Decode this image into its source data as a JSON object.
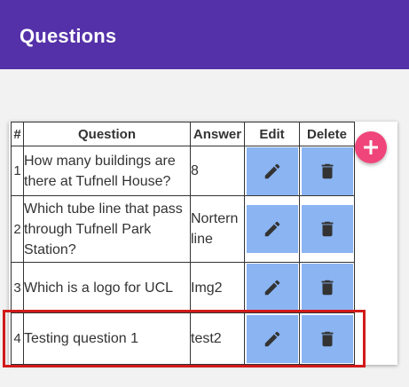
{
  "app_bar": {
    "title": "Questions",
    "color": "#5431a9"
  },
  "table": {
    "headers": {
      "num": "#",
      "question": "Question",
      "answer": "Answer",
      "edit": "Edit",
      "delete": "Delete"
    },
    "rows": [
      {
        "num": "1",
        "question": "How many buildings are there at Tufnell House?",
        "answer": "8"
      },
      {
        "num": "2",
        "question": "Which tube line that pass through Tufnell Park Station?",
        "answer": "Nortern line"
      },
      {
        "num": "3",
        "question": "Which is a logo for UCL",
        "answer": "Img2"
      },
      {
        "num": "4",
        "question": "Testing question 1",
        "answer": "test2"
      }
    ],
    "row_actions": {
      "edit_icon": "pencil-icon",
      "delete_icon": "trash-icon",
      "button_color": "#8ab4f2"
    }
  },
  "fab": {
    "icon": "plus-icon",
    "color": "#f0457a"
  },
  "highlight": {
    "color": "#d11a1a",
    "target_row": "4"
  }
}
